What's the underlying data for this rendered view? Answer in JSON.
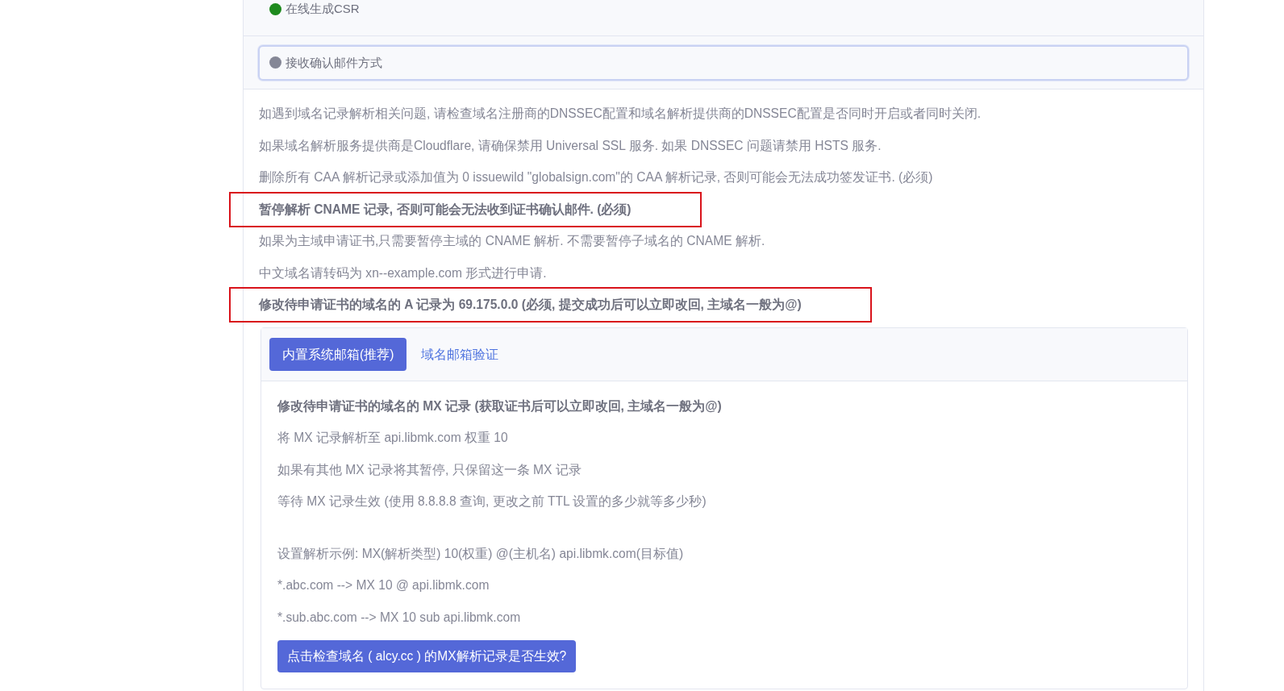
{
  "steps": [
    {
      "label": "在线生成CSR",
      "color": "#1e8a1e",
      "selected": false
    },
    {
      "label": "接收确认邮件方式",
      "color": "#858796",
      "selected": true
    }
  ],
  "notes": [
    {
      "text": "如遇到域名记录解析相关问题, 请检查域名注册商的DNSSEC配置和域名解析提供商的DNSSEC配置是否同时开启或者同时关闭.",
      "kind": "plain",
      "highlighted": false
    },
    {
      "text": "如果域名解析服务提供商是Cloudflare, 请确保禁用 Universal SSL 服务. 如果 DNSSEC 问题请禁用 HSTS 服务.",
      "kind": "plain",
      "highlighted": false
    },
    {
      "text": "删除所有 CAA 解析记录或添加值为 0 issuewild \"globalsign.com\"的 CAA 解析记录, 否则可能会无法成功签发证书. (必须)",
      "kind": "plain",
      "highlighted": false
    },
    {
      "text": "暂停解析 CNAME 记录, 否则可能会无法收到证书确认邮件. (必须)",
      "kind": "bold",
      "highlighted": true
    },
    {
      "text": "如果为主域申请证书,只需要暂停主域的 CNAME 解析. 不需要暂停子域名的 CNAME 解析.",
      "kind": "plain",
      "highlighted": false
    },
    {
      "text": "中文域名请转码为 xn--example.com 形式进行申请.",
      "kind": "plain",
      "highlighted": false
    },
    {
      "text": "修改待申请证书的域名的 A 记录为 69.175.0.0 (必须, 提交成功后可以立即改回, 主域名一般为@)",
      "kind": "bold",
      "highlighted": true
    }
  ],
  "tabs": [
    {
      "label": "内置系统邮箱(推荐)",
      "selected": true
    },
    {
      "label": "域名邮箱验证",
      "selected": false
    }
  ],
  "panel": {
    "heading": "修改待申请证书的域名的 MX 记录 (获取证书后可以立即改回, 主域名一般为@)",
    "groups": [
      [
        "将 MX 记录解析至 api.libmk.com 权重 10",
        "如果有其他 MX 记录将其暂停, 只保留这一条 MX 记录",
        "等待 MX 记录生效 (使用 8.8.8.8 查询, 更改之前 TTL 设置的多少就等多少秒)"
      ],
      [
        "设置解析示例: MX(解析类型) 10(权重) @(主机名) api.libmk.com(目标值)",
        "*.abc.com --> MX 10 @ api.libmk.com",
        "*.sub.abc.com --> MX 10 sub api.libmk.com"
      ]
    ],
    "button": "点击检查域名 ( alcy.cc ) 的MX解析记录是否生效?"
  }
}
